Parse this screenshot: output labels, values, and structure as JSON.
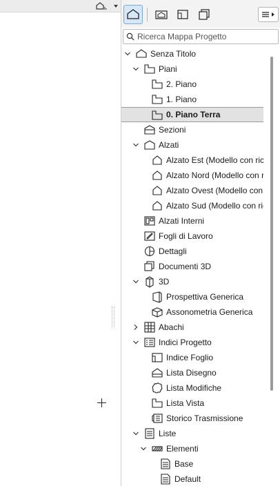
{
  "search": {
    "placeholder": "Ricerca Mappa Progetto"
  },
  "toolbar": {
    "buttons": [
      "project-map-icon",
      "view-map-icon",
      "layout-book-icon",
      "publisher-sets-icon"
    ],
    "menu": "menu-icon"
  },
  "tree": [
    {
      "label": "Senza Titolo",
      "icon": "project-house-icon",
      "level": 0,
      "chevron": "down"
    },
    {
      "label": "Piani",
      "icon": "stories-folder-icon",
      "level": 1,
      "chevron": "down"
    },
    {
      "label": "2. Piano",
      "icon": "story-icon",
      "level": 2,
      "chevron": ""
    },
    {
      "label": "1. Piano",
      "icon": "story-icon",
      "level": 2,
      "chevron": ""
    },
    {
      "label": "0. Piano Terra",
      "icon": "story-icon",
      "level": 2,
      "chevron": "",
      "selected": true
    },
    {
      "label": "Sezioni",
      "icon": "section-icon",
      "level": 1,
      "chevron": ""
    },
    {
      "label": "Alzati",
      "icon": "elevation-folder-icon",
      "level": 1,
      "chevron": "down"
    },
    {
      "label": "Alzato Est (Modello con rico",
      "icon": "elevation-icon",
      "level": 2,
      "chevron": ""
    },
    {
      "label": "Alzato Nord (Modello con ri",
      "icon": "elevation-icon",
      "level": 2,
      "chevron": ""
    },
    {
      "label": "Alzato Ovest (Modello con r",
      "icon": "elevation-icon",
      "level": 2,
      "chevron": ""
    },
    {
      "label": "Alzato Sud (Modello con rico",
      "icon": "elevation-icon",
      "level": 2,
      "chevron": ""
    },
    {
      "label": "Alzati Interni",
      "icon": "interior-elevation-icon",
      "level": 1,
      "chevron": ""
    },
    {
      "label": "Fogli di Lavoro",
      "icon": "worksheet-icon",
      "level": 1,
      "chevron": ""
    },
    {
      "label": "Dettagli",
      "icon": "detail-icon",
      "level": 1,
      "chevron": ""
    },
    {
      "label": "Documenti 3D",
      "icon": "3d-document-icon",
      "level": 1,
      "chevron": ""
    },
    {
      "label": "3D",
      "icon": "3d-folder-icon",
      "level": 1,
      "chevron": "down"
    },
    {
      "label": "Prospettiva Generica",
      "icon": "perspective-icon",
      "level": 2,
      "chevron": ""
    },
    {
      "label": "Assonometria Generica",
      "icon": "axonometry-icon",
      "level": 2,
      "chevron": ""
    },
    {
      "label": "Abachi",
      "icon": "schedule-icon",
      "level": 1,
      "chevron": "right"
    },
    {
      "label": "Indici Progetto",
      "icon": "project-index-icon",
      "level": 1,
      "chevron": "down"
    },
    {
      "label": "Indice Foglio",
      "icon": "sheet-index-icon",
      "level": 2,
      "chevron": ""
    },
    {
      "label": "Lista Disegno",
      "icon": "drawing-list-icon",
      "level": 2,
      "chevron": ""
    },
    {
      "label": "Lista Modifiche",
      "icon": "change-list-icon",
      "level": 2,
      "chevron": ""
    },
    {
      "label": "Lista Vista",
      "icon": "view-list-icon",
      "level": 2,
      "chevron": ""
    },
    {
      "label": "Storico Trasmissione",
      "icon": "transmittal-history-icon",
      "level": 2,
      "chevron": ""
    },
    {
      "label": "Liste",
      "icon": "lists-icon",
      "level": 1,
      "chevron": "down"
    },
    {
      "label": "Elementi",
      "icon": "elements-icon",
      "level": 2,
      "chevron": "down"
    },
    {
      "label": "Base",
      "icon": "list-doc-icon",
      "level": 3,
      "chevron": ""
    },
    {
      "label": "Default",
      "icon": "list-doc-icon",
      "level": 3,
      "chevron": ""
    }
  ]
}
